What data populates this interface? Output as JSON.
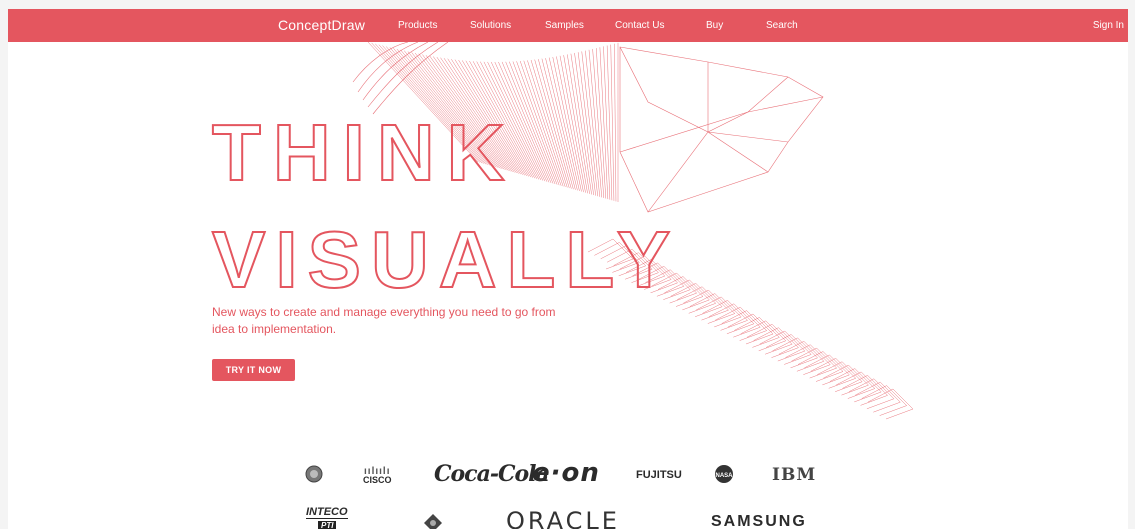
{
  "nav": {
    "brand": "ConceptDraw",
    "items": [
      "Products",
      "Solutions",
      "Samples",
      "Contact Us",
      "Buy",
      "Search"
    ],
    "signin": "Sign In"
  },
  "hero": {
    "headline_line1": "THINK",
    "headline_line2": "VISUALLY",
    "tagline_line1": "New ways to create and manage everything you need to go from",
    "tagline_line2": "idea to implementation.",
    "cta_label": "TRY IT NOW"
  },
  "logos": {
    "cisco": "CISCO",
    "coke": "Coca-Cola",
    "eon": "e·on",
    "fujitsu": "FUJITSU",
    "nasa": "NASA",
    "ibm": "IBM",
    "inteco": "INTECO",
    "inteco_sub": "PTI",
    "oracle": "ORACLE",
    "samsung": "SAMSUNG"
  },
  "colors": {
    "brand": "#e4565f",
    "background": "#ffffff"
  }
}
